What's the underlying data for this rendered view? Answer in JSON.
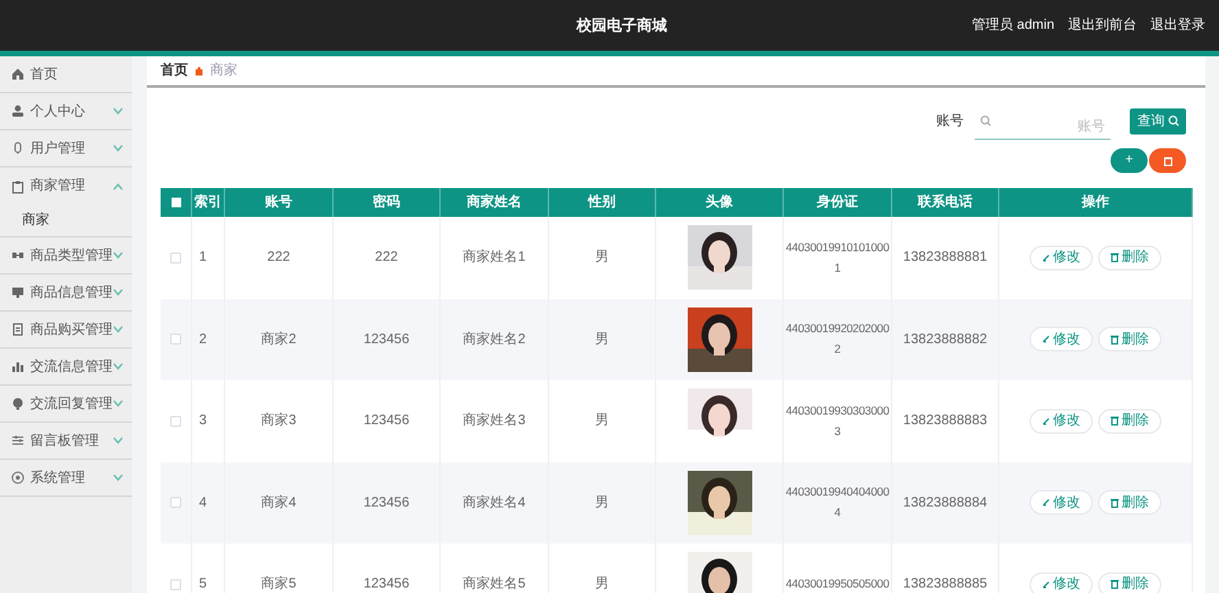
{
  "header": {
    "title": "校园电子商城",
    "links": [
      "管理员 admin",
      "退出到前台",
      "退出登录"
    ]
  },
  "sidebar": {
    "items": [
      {
        "label": "首页"
      },
      {
        "label": "个人中心",
        "expanded": false
      },
      {
        "label": "用户管理",
        "expanded": false
      },
      {
        "label": "商家管理",
        "expanded": true,
        "children": [
          {
            "label": "商家"
          }
        ]
      },
      {
        "label": "商品类型管理",
        "expanded": false
      },
      {
        "label": "商品信息管理",
        "expanded": false
      },
      {
        "label": "商品购买管理",
        "expanded": false
      },
      {
        "label": "交流信息管理",
        "expanded": false
      },
      {
        "label": "交流回复管理",
        "expanded": false
      },
      {
        "label": "留言板管理",
        "expanded": false
      },
      {
        "label": "系统管理",
        "expanded": false
      }
    ]
  },
  "breadcrumb": [
    "首页",
    "商家"
  ],
  "search": {
    "label": "账号",
    "placeholder": "账号",
    "button": "查询"
  },
  "actions": {
    "add": "+"
  },
  "table": {
    "select_all_checked": false,
    "columns": [
      "索引",
      "账号",
      "密码",
      "商家姓名",
      "性别",
      "头像",
      "身份证",
      "联系电话",
      "操作"
    ],
    "rows": [
      {
        "selected": false,
        "cells": [
          "1",
          "222",
          "222",
          "商家姓名1",
          "男",
          {
            "kind": "picture"
          },
          "440300199101010001",
          "13823888881",
          {
            "kind": "actions",
            "edit": "修改",
            "delete": "删除"
          }
        ]
      },
      {
        "selected": false,
        "cells": [
          "2",
          "商家2",
          "123456",
          "商家姓名2",
          "男",
          {
            "kind": "picture"
          },
          "440300199202020002",
          "13823888882",
          {
            "kind": "actions",
            "edit": "修改",
            "delete": "删除"
          }
        ]
      },
      {
        "selected": false,
        "cells": [
          "3",
          "商家3",
          "123456",
          "商家姓名3",
          "男",
          {
            "kind": "picture"
          },
          "440300199303030003",
          "13823888883",
          {
            "kind": "actions",
            "edit": "修改",
            "delete": "删除"
          }
        ]
      },
      {
        "selected": false,
        "cells": [
          "4",
          "商家4",
          "123456",
          "商家姓名4",
          "男",
          {
            "kind": "picture"
          },
          "440300199404040004",
          "13823888884",
          {
            "kind": "actions",
            "edit": "修改",
            "delete": "删除"
          }
        ]
      },
      {
        "selected": false,
        "cells": [
          "5",
          "商家5",
          "123456",
          "商家姓名5",
          "男",
          {
            "kind": "picture"
          },
          "44030019950505000",
          "13823888885",
          {
            "kind": "actions",
            "edit": "修改",
            "delete": "删除"
          }
        ]
      }
    ]
  }
}
